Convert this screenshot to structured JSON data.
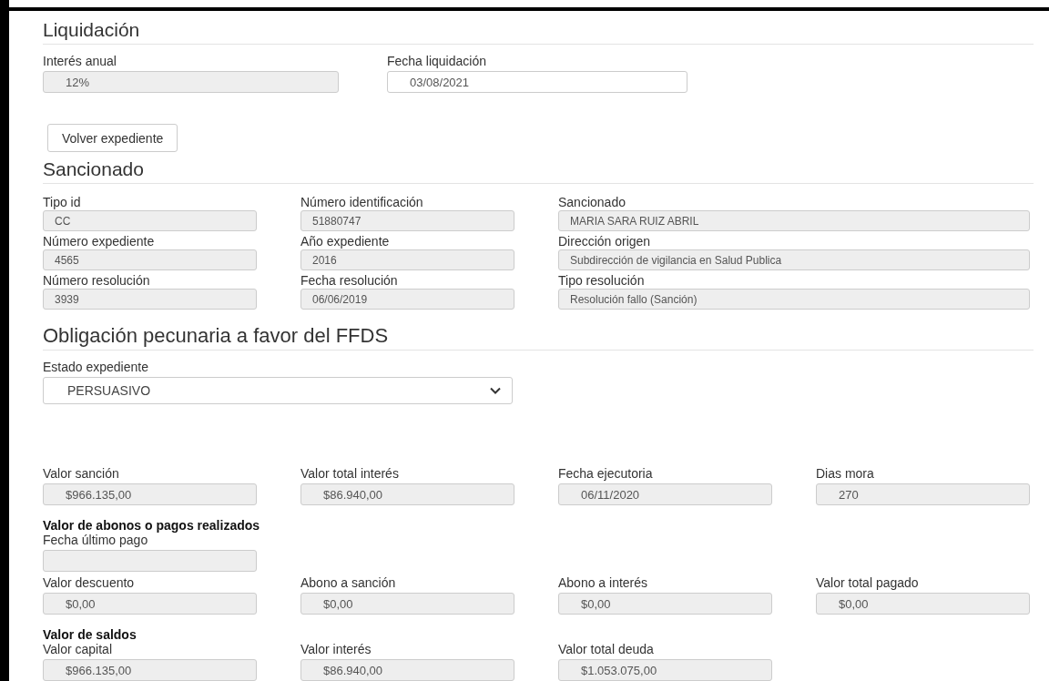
{
  "liquidacion": {
    "title": "Liquidación",
    "fields": [
      {
        "label": "Interés anual",
        "value": "12%",
        "disabled": true
      },
      {
        "label": "Fecha liquidación",
        "value": "03/08/2021",
        "disabled": false
      }
    ]
  },
  "back_button": "Volver expediente",
  "sancionado": {
    "title": "Sancionado",
    "fields": [
      {
        "label": "Tipo id",
        "value": "CC",
        "disabled": true
      },
      {
        "label": "Número identificación",
        "value": "51880747",
        "disabled": true
      },
      {
        "label": "Sancionado",
        "value": "MARIA SARA RUIZ ABRIL",
        "disabled": true,
        "wide": true
      },
      {
        "label": "Número expediente",
        "value": "4565",
        "disabled": true
      },
      {
        "label": "Año expediente",
        "value": "2016",
        "disabled": true
      },
      {
        "label": "Dirección origen",
        "value": "Subdirección de vigilancia en Salud Publica",
        "disabled": true,
        "wide": true
      },
      {
        "label": "Número resolución",
        "value": "3939",
        "disabled": true
      },
      {
        "label": "Fecha resolución",
        "value": "06/06/2019",
        "disabled": true
      },
      {
        "label": "Tipo resolución",
        "value": "Resolución fallo (Sanción)",
        "disabled": true,
        "wide": true
      }
    ]
  },
  "obligacion": {
    "title": "Obligación pecunaria a favor del FFDS",
    "estado": {
      "label": "Estado expediente",
      "value": "PERSUASIVO"
    },
    "groups": [
      {
        "fields": [
          {
            "label": "Valor sanción",
            "value": "$966.135,00",
            "disabled": true
          },
          {
            "label": "Valor total interés",
            "value": "$86.940,00",
            "disabled": true
          },
          {
            "label": "Fecha ejecutoria",
            "value": "06/11/2020",
            "disabled": true
          },
          {
            "label": "Dias mora",
            "value": "270",
            "disabled": true
          }
        ]
      },
      {
        "heading": "Valor de abonos o pagos realizados",
        "lead_field": {
          "label": "Fecha último pago",
          "disabled": true
        },
        "fields": [
          {
            "label": "Valor descuento",
            "value": "$0,00",
            "disabled": true
          },
          {
            "label": "Abono a sanción",
            "value": "$0,00",
            "disabled": true
          },
          {
            "label": "Abono a interés",
            "value": "$0,00",
            "disabled": true
          },
          {
            "label": "Valor total pagado",
            "value": "$0,00",
            "disabled": true
          }
        ]
      },
      {
        "heading": "Valor de saldos",
        "fields": [
          {
            "label": "Valor capital",
            "value": "$966.135,00",
            "disabled": true
          },
          {
            "label": "Valor interés",
            "value": "$86.940,00",
            "disabled": true
          },
          {
            "label": "Valor total deuda",
            "value": "$1.053.075,00",
            "disabled": true
          }
        ]
      }
    ]
  }
}
